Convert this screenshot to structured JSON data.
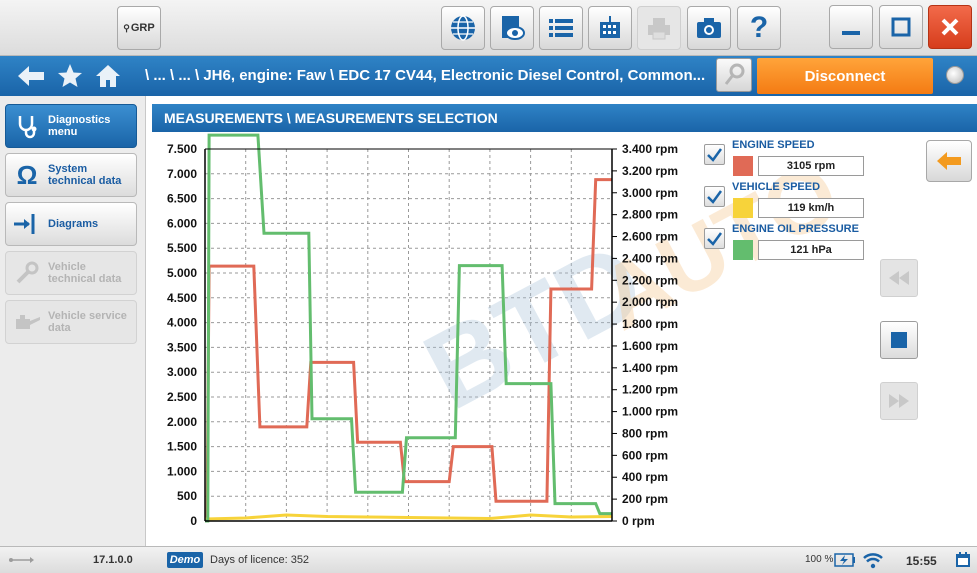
{
  "toolbar": {
    "grp_label": "GRP",
    "help_label": "?"
  },
  "navbar": {
    "breadcrumb": "\\ ... \\ ... \\ JH6, engine: Faw \\ EDC 17 CV44, Electronic Diesel Control, Common...",
    "disconnect_label": "Disconnect"
  },
  "sidebar": {
    "items": [
      {
        "label": "Diagnostics menu",
        "icon": "stethoscope-icon",
        "state": "active"
      },
      {
        "label": "System technical data",
        "icon": "omega-icon",
        "state": "normal"
      },
      {
        "label": "Diagrams",
        "icon": "diagram-connector-icon",
        "state": "normal"
      },
      {
        "label": "Vehicle technical data",
        "icon": "wrench-icon",
        "state": "disabled"
      },
      {
        "label": "Vehicle service data",
        "icon": "oil-can-icon",
        "state": "disabled"
      }
    ]
  },
  "section": {
    "title": "MEASUREMENTS \\ MEASUREMENTS SELECTION"
  },
  "legend": {
    "items": [
      {
        "title": "ENGINE SPEED",
        "value": "3105 rpm",
        "color": "#e06a56"
      },
      {
        "title": "VEHICLE SPEED",
        "value": "119 km/h",
        "color": "#f7d33a"
      },
      {
        "title": "ENGINE OIL PRESSURE",
        "value": "121 hPa",
        "color": "#63bd6e"
      }
    ]
  },
  "chart_data": {
    "type": "line",
    "left_axis": {
      "min": 0,
      "max": 7500,
      "ticks": [
        "0",
        "500",
        "1.000",
        "1.500",
        "2.000",
        "2.500",
        "3.000",
        "3.500",
        "4.000",
        "4.500",
        "5.000",
        "5.500",
        "6.000",
        "6.500",
        "7.000",
        "7.500"
      ]
    },
    "right_axis": {
      "min": 0,
      "max": 3400,
      "ticks": [
        "0 rpm",
        "200 rpm",
        "400 rpm",
        "600 rpm",
        "800 rpm",
        "1.000 rpm",
        "1.200 rpm",
        "1.400 rpm",
        "1.600 rpm",
        "1.800 rpm",
        "2.000 rpm",
        "2.200 rpm",
        "2.400 rpm",
        "2.600 rpm",
        "2.800 rpm",
        "3.000 rpm",
        "3.200 rpm",
        "3.400 rpm"
      ]
    },
    "grid": true,
    "x_range": [
      0,
      100
    ],
    "series": [
      {
        "name": "ENGINE SPEED",
        "axis": "right",
        "color": "#e06a56",
        "points": [
          [
            0,
            0
          ],
          [
            0.5,
            0
          ],
          [
            1,
            2330
          ],
          [
            12,
            2330
          ],
          [
            13.5,
            860
          ],
          [
            25,
            860
          ],
          [
            26,
            1450
          ],
          [
            36.5,
            1450
          ],
          [
            37.5,
            720
          ],
          [
            48,
            720
          ],
          [
            49,
            360
          ],
          [
            60,
            360
          ],
          [
            61,
            680
          ],
          [
            70.5,
            680
          ],
          [
            71.5,
            180
          ],
          [
            84,
            180
          ],
          [
            85,
            2120
          ],
          [
            95,
            2120
          ],
          [
            96,
            3120
          ],
          [
            100,
            3120
          ]
        ]
      },
      {
        "name": "VEHICLE SPEED",
        "axis": "left",
        "color": "#f7d33a",
        "points": [
          [
            0,
            40
          ],
          [
            10,
            60
          ],
          [
            20,
            120
          ],
          [
            30,
            90
          ],
          [
            40,
            80
          ],
          [
            50,
            70
          ],
          [
            60,
            60
          ],
          [
            70,
            50
          ],
          [
            80,
            120
          ],
          [
            90,
            80
          ],
          [
            100,
            90
          ]
        ]
      },
      {
        "name": "ENGINE OIL PRESSURE",
        "axis": "left",
        "color": "#63bd6e",
        "points": [
          [
            0,
            0
          ],
          [
            0.7,
            0
          ],
          [
            1,
            7780
          ],
          [
            13,
            7780
          ],
          [
            14.5,
            5800
          ],
          [
            25.5,
            5800
          ],
          [
            26.3,
            2060
          ],
          [
            36,
            2060
          ],
          [
            37,
            580
          ],
          [
            48.5,
            580
          ],
          [
            49.5,
            1680
          ],
          [
            61.5,
            1680
          ],
          [
            62.5,
            5150
          ],
          [
            73,
            5150
          ],
          [
            74,
            2770
          ],
          [
            85,
            2770
          ],
          [
            86,
            350
          ],
          [
            96,
            350
          ],
          [
            97,
            150
          ],
          [
            100,
            150
          ]
        ]
      }
    ]
  },
  "status": {
    "version": "17.1.0.0",
    "demo_label": "Demo",
    "licence": "Days of licence: 352",
    "battery": "100 %",
    "time": "15:55"
  }
}
